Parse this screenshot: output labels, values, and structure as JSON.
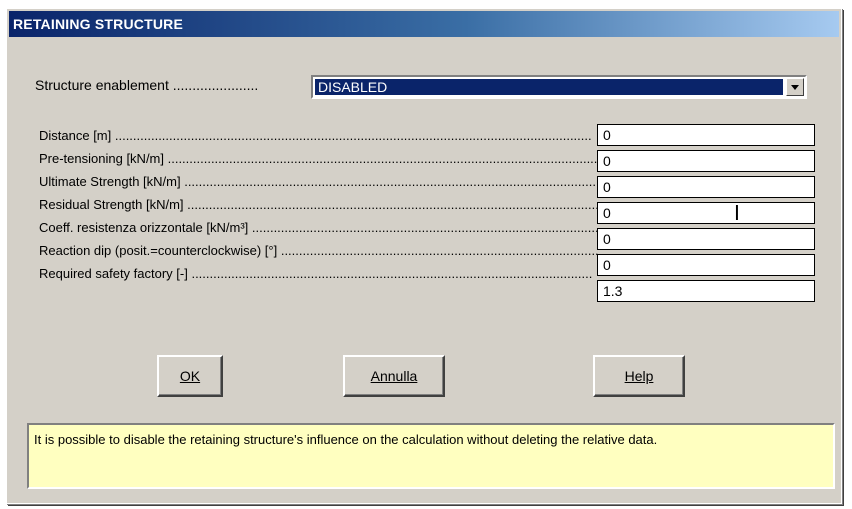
{
  "window": {
    "title": "RETAINING STRUCTURE"
  },
  "enablement": {
    "label": "Structure enablement ......................",
    "selected": "DISABLED"
  },
  "fields": [
    {
      "label": "Distance [m] ....................................................................................................................................",
      "value": "0"
    },
    {
      "label": "Pre-tensioning [kN/m] ...........................................................................................................................",
      "value": "0"
    },
    {
      "label": "Ultimate Strength [kN/m] ......................................................................................................................",
      "value": "0"
    },
    {
      "label": "Residual Strength [kN/m] .......................................................................................................................",
      "value": "0"
    },
    {
      "label": "Coeff. resistenza orizzontale [kN/m³] ..........................................................................................................",
      "value": "0"
    },
    {
      "label": "Reaction dip (posit.=counterclockwise) [°] ...................................................................................................",
      "value": "0"
    },
    {
      "label": "Required safety factory [-] ...............................................................................................................",
      "value": "1.3"
    }
  ],
  "buttons": {
    "ok": "OK",
    "cancel": "Annulla",
    "help": "Help"
  },
  "message": "It is possible to disable the retaining structure's influence on the calculation without deleting the relative data.",
  "icons": {
    "dropdown": "chevron-down-icon",
    "cursor": "text-cursor-icon"
  }
}
